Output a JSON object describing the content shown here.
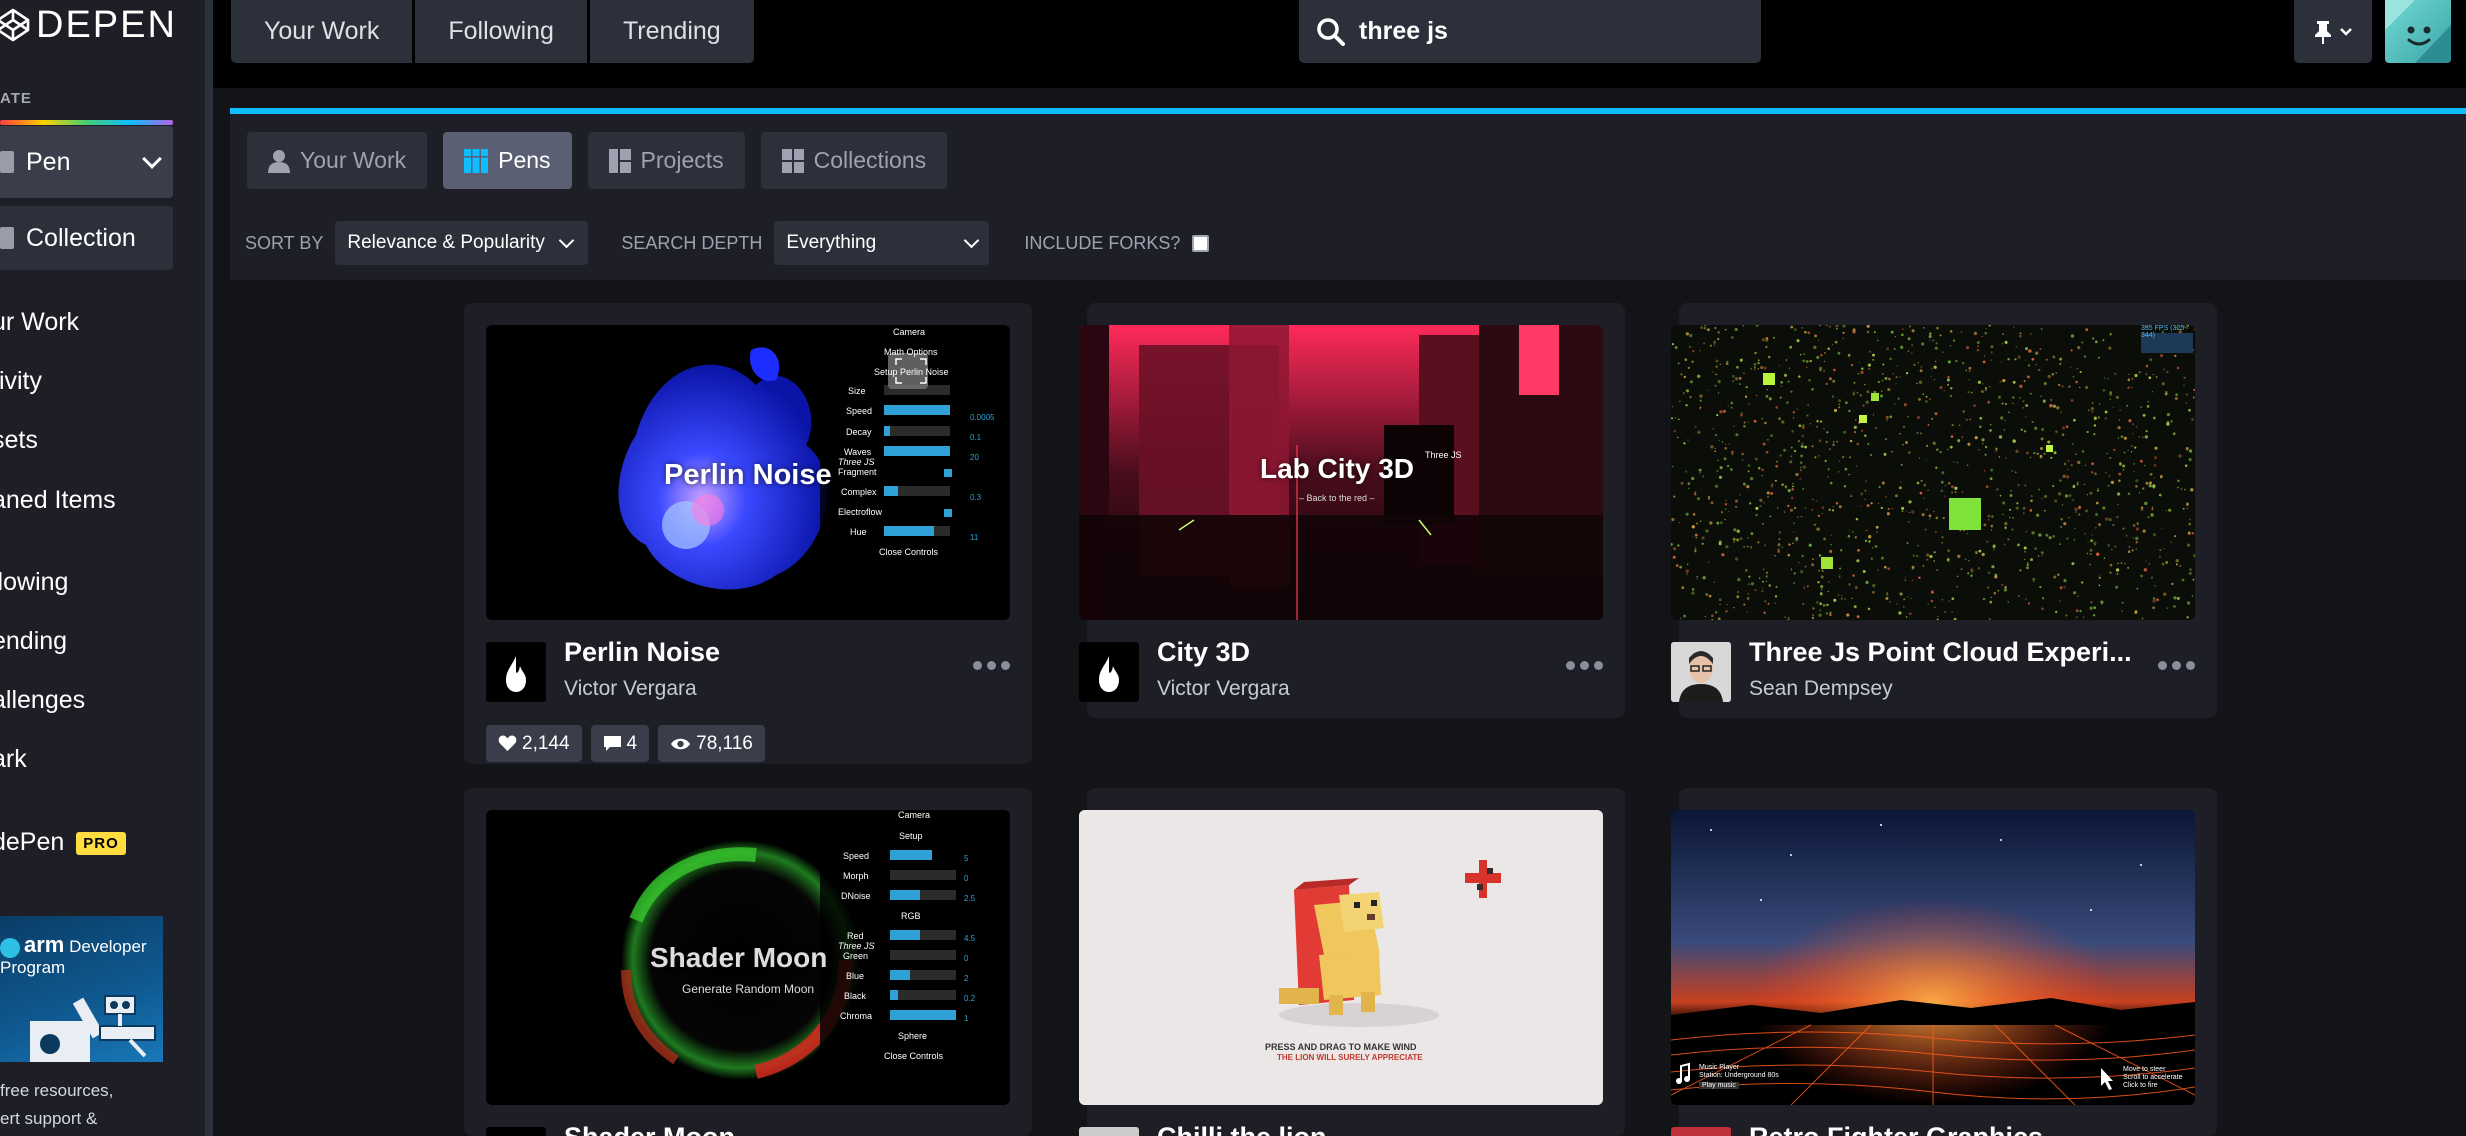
{
  "app": {
    "logo_text": "DEPEN"
  },
  "sidebar": {
    "create_label": "ATE",
    "pen_label": "Pen",
    "collection_label": "Collection",
    "nav": [
      "ur Work",
      "tivity",
      "sets",
      "aned Items",
      "llowing",
      "ending",
      "allenges",
      "ark"
    ],
    "pro_label": "dePen",
    "pro_badge": "PRO",
    "ad": {
      "brand": "arm",
      "program": "Developer Program",
      "line1": "free resources,",
      "line2": "ert support &"
    }
  },
  "topbar": {
    "tabs": [
      "Your Work",
      "Following",
      "Trending"
    ],
    "search_value": "three js"
  },
  "search_panel": {
    "tabs": [
      "Your Work",
      "Pens",
      "Projects",
      "Collections"
    ],
    "active_tab": "Pens",
    "sort_by_label": "SORT BY",
    "sort_value": "Relevance & Popularity",
    "depth_label": "SEARCH DEPTH",
    "depth_value": "Everything",
    "forks_label": "INCLUDE FORKS?"
  },
  "cards": [
    {
      "title": "Perlin Noise",
      "author": "Victor Vergara",
      "likes": "2,144",
      "comments": "4",
      "views": "78,116",
      "thumb_title": "Perlin Noise",
      "gui": {
        "camera": "Camera",
        "math": "Math Options",
        "setup": "Setup Perlin Noise",
        "rows": [
          "Size",
          "Speed",
          "Decay",
          "Waves",
          "Fragment",
          "Complex",
          "Electroflow",
          "Hue"
        ],
        "values": [
          "0.0005",
          "0.1",
          "20",
          "0.3",
          "11"
        ],
        "overlay": "Three JS",
        "close": "Close Controls"
      }
    },
    {
      "title": "City 3D",
      "author": "Victor Vergara",
      "thumb_title": "Lab City 3D",
      "thumb_sub": "– Back to the red –",
      "thumb_tag": "Three JS"
    },
    {
      "title": "Three Js Point Cloud Experi...",
      "author": "Sean Dempsey",
      "thumb_fps": "335 FPS (325-344)"
    },
    {
      "title": "Shader Moon",
      "thumb_title": "Shader Moon",
      "thumb_sub": "Generate Random Moon",
      "gui": {
        "camera": "Camera",
        "setup": "Setup",
        "rows1": [
          "Speed",
          "Morph",
          "DNoise"
        ],
        "values1": [
          "5",
          "0",
          "2.5"
        ],
        "rgb": "RGB",
        "rows2": [
          "Red",
          "Green",
          "Blue",
          "Black",
          "Chroma"
        ],
        "values2": [
          "4.5",
          "0",
          "2",
          "0.2",
          "1"
        ],
        "overlay": "Three JS",
        "sphere": "Sphere",
        "close": "Close Controls"
      }
    },
    {
      "title": "Chilli the lion",
      "thumb_line1": "PRESS AND DRAG TO MAKE WIND",
      "thumb_line2": "THE LION WILL SURELY APPRECIATE"
    },
    {
      "title": "Retro Fighter Graphics",
      "thumb_player": "Music Player",
      "thumb_station": "Station: Underground 80s",
      "thumb_play": "Play music",
      "thumb_right1": "Move to steer",
      "thumb_right2": "Scroll to accelerate",
      "thumb_right3": "Click to fire"
    }
  ],
  "colors": {
    "accent": "#0ebeff",
    "pro_badge": "#ffdd40",
    "active_tab": "#5a5f73"
  }
}
